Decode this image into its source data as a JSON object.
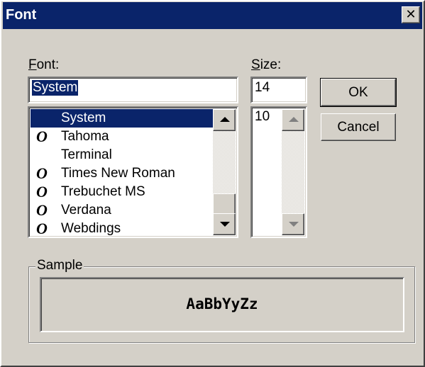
{
  "window": {
    "title": "Font",
    "close_symbol": "✕"
  },
  "font_label": {
    "accel": "F",
    "rest": "ont:"
  },
  "size_label": {
    "accel": "S",
    "rest": "ize:"
  },
  "font_input": {
    "value": "System"
  },
  "size_input": {
    "value": "14"
  },
  "font_list": {
    "items": [
      {
        "label": "System",
        "truetype": false,
        "selected": true
      },
      {
        "label": "Tahoma",
        "truetype": true,
        "selected": false
      },
      {
        "label": "Terminal",
        "truetype": false,
        "selected": false
      },
      {
        "label": "Times New Roman",
        "truetype": true,
        "selected": false
      },
      {
        "label": "Trebuchet MS",
        "truetype": true,
        "selected": false
      },
      {
        "label": "Verdana",
        "truetype": true,
        "selected": false
      },
      {
        "label": "Webdings",
        "truetype": true,
        "selected": false
      }
    ],
    "truetype_glyph": "O",
    "icon": "truetype-font-icon"
  },
  "size_list": {
    "items": [
      "10"
    ]
  },
  "buttons": {
    "ok": "OK",
    "cancel": "Cancel"
  },
  "sample": {
    "label": "Sample",
    "text": "AaBbYyZz"
  },
  "colors": {
    "face": "#d4d0c8",
    "titlebar": "#0a246a",
    "selection": "#0a246a"
  }
}
